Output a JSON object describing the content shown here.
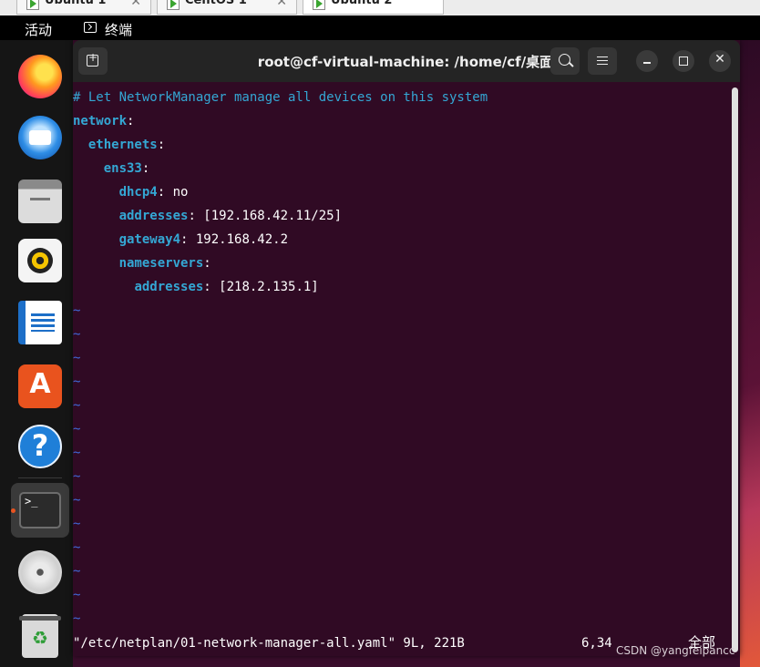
{
  "vm_tabs": [
    {
      "label": "Ubuntu 1"
    },
    {
      "label": "CentOS 1"
    },
    {
      "label": "Ubuntu 2",
      "active": true
    }
  ],
  "topbar": {
    "activities": "活动",
    "app_name": "终端"
  },
  "window": {
    "title": "root@cf-virtual-machine: /home/cf/桌面"
  },
  "file": {
    "lines": [
      {
        "comment": "# Let NetworkManager manage all devices on this system"
      },
      {
        "indent": "",
        "key": "network",
        "sep": ":",
        "value": ""
      },
      {
        "indent": "  ",
        "key": "ethernets",
        "sep": ":",
        "value": ""
      },
      {
        "indent": "    ",
        "key": "ens33",
        "sep": ":",
        "value": ""
      },
      {
        "indent": "      ",
        "key": "dhcp4",
        "sep": ":",
        "value": " no"
      },
      {
        "indent": "      ",
        "key": "addresses",
        "sep": ":",
        "value": " [192.168.42.11/25]"
      },
      {
        "indent": "      ",
        "key": "gateway4",
        "sep": ":",
        "value": " 192.168.42.2"
      },
      {
        "indent": "      ",
        "key": "nameservers",
        "sep": ":",
        "value": ""
      },
      {
        "indent": "        ",
        "key": "addresses",
        "sep": ":",
        "value": " [218.2.135.1]"
      }
    ],
    "empty_line_marker": "~",
    "empty_line_count": 14
  },
  "statusline": {
    "file_info": "\"/etc/netplan/01-network-manager-all.yaml\" 9L, 221B",
    "cursor_pos": "6,34",
    "scroll_pos": "全部"
  },
  "watermark": "CSDN @yangfeipancc",
  "colors": {
    "terminal_bg": "#300a24",
    "key": "#34a7d4",
    "tilde": "#3f6ad8",
    "accent": "#e95420"
  },
  "dock": {
    "icons": [
      "firefox-icon",
      "thunderbird-icon",
      "files-icon",
      "rhythmbox-icon",
      "libreoffice-writer-icon",
      "software-center-icon",
      "help-icon",
      "terminal-icon",
      "disc-icon",
      "trash-icon"
    ],
    "software_glyph": "A",
    "help_glyph": "?",
    "terminal_glyph": ">_",
    "trash_glyph": "♻"
  }
}
